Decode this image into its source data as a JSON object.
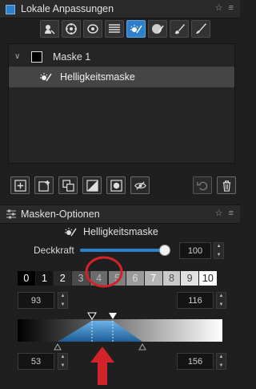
{
  "top_panel": {
    "title": "Lokale Anpassungen",
    "window_controls": "☆ ≡"
  },
  "toolbar": {
    "tools": [
      {
        "name": "layer-tool"
      },
      {
        "name": "radial-tool"
      },
      {
        "name": "lens-tool"
      },
      {
        "name": "gradient-lines-tool"
      },
      {
        "name": "luma-mask-tool",
        "active": true
      },
      {
        "name": "eraser-tool"
      },
      {
        "name": "brush-tool"
      },
      {
        "name": "draw-tool"
      }
    ]
  },
  "mask_list": {
    "items": [
      {
        "label": "Maske 1",
        "expanded": true
      },
      {
        "label": "Helligkeitsmaske",
        "selected": true
      }
    ]
  },
  "mask_options": {
    "title": "Masken-Optionen",
    "window_controls": "☆ ≡",
    "mask_type_label": "Helligkeitsmaske",
    "opacity_label": "Deckkraft",
    "opacity_value": "100",
    "opacity_fraction": 0.95,
    "zones": [
      "0",
      "1",
      "2",
      "3",
      "4",
      "5",
      "6",
      "7",
      "8",
      "9",
      "10"
    ],
    "range_low": "93",
    "range_high": "116",
    "falloff_low": "53",
    "falloff_high": "156"
  },
  "colors": {
    "accent": "#2e80c8",
    "annotation": "#d2232a"
  }
}
